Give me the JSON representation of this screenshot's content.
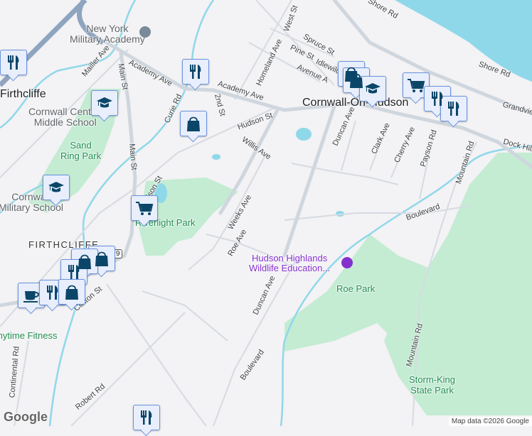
{
  "colors": {
    "land": "#f3f2f4",
    "water": "#8fd8ea",
    "park": "#c3ecd3",
    "road": "#d5dbe2",
    "highway": "#8fa5bf",
    "marker_fill": "#e8eefc",
    "marker_icon": "#0b4668"
  },
  "places": {
    "nyma": "New York\nMilitary Academy",
    "middle_school": "Cornwall Central\nMiddle School",
    "firthcliffe": "Firthcliffe",
    "firthcliffe_caps": "FIRTHCLIFFE",
    "cornwall_on_hudson": "Cornwall-On-Hudson",
    "military_school": "Cornwall\nMilitary School",
    "hudson_highlands": "Hudson Highlands\nWildlife Education...",
    "anytime_fitness": "Anytime Fitness"
  },
  "parks": {
    "sand_ring": "Sand\nRing Park",
    "riverlight": "Riverlight Park",
    "roe": "Roe Park",
    "storm_king": "Storm-King\nState Park"
  },
  "streets": {
    "mailler": "Mailler Ave",
    "main": "Main St",
    "academy": "Academy Ave",
    "curie": "Curie Rd",
    "second": "2nd St",
    "hudson": "Hudson St",
    "willis": "Willis Ave",
    "homeland": "Homeland Ave",
    "west": "West St",
    "spruce": "Spruce St",
    "pine": "Pine St",
    "avenue_a": "Avenue A",
    "idlewild": "Idlewild",
    "shore": "Shore Rd",
    "grandview": "Grandview",
    "dock_hill": "Dock Hill",
    "duncan": "Duncan Ave",
    "clark": "Clark Ave",
    "cherry": "Cherry Ave",
    "payson": "Payson Rd",
    "mountain": "Mountain Rd",
    "boulevard": "Boulevard",
    "weeks": "Weeks Ave",
    "roe": "Roe Ave",
    "clinton": "Clinton St",
    "robert": "Robert Rd",
    "continental": "Continental Rd",
    "route": "9"
  },
  "markers": [
    "restaurant",
    "restaurant",
    "school",
    "shopping",
    "school",
    "grocery",
    "shopping",
    "shopping",
    "school",
    "grocery",
    "restaurant",
    "restaurant",
    "shopping",
    "shopping",
    "restaurant",
    "cafe",
    "restaurant",
    "shopping",
    "restaurant"
  ],
  "footer": {
    "logo": "Google",
    "attribution": "Map data ©2026 Google"
  }
}
